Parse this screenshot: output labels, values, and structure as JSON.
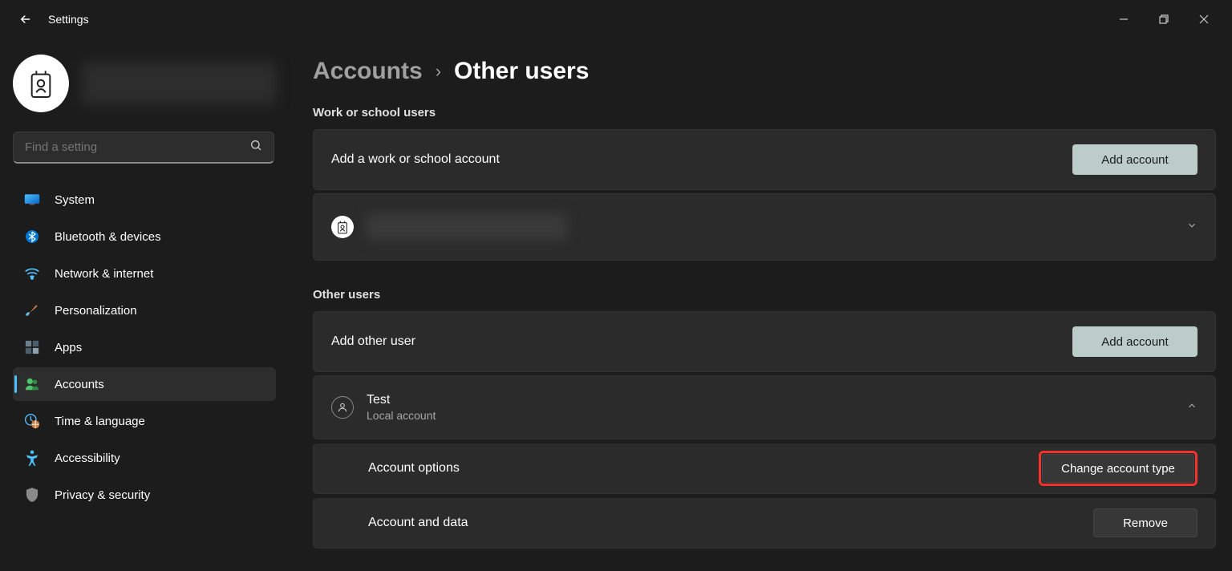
{
  "app_title": "Settings",
  "search": {
    "placeholder": "Find a setting"
  },
  "nav": {
    "items": [
      {
        "label": "System"
      },
      {
        "label": "Bluetooth & devices"
      },
      {
        "label": "Network & internet"
      },
      {
        "label": "Personalization"
      },
      {
        "label": "Apps"
      },
      {
        "label": "Accounts"
      },
      {
        "label": "Time & language"
      },
      {
        "label": "Accessibility"
      },
      {
        "label": "Privacy & security"
      }
    ],
    "selected_index": 5
  },
  "breadcrumb": {
    "parent": "Accounts",
    "current": "Other users"
  },
  "sections": {
    "work": {
      "title": "Work or school users",
      "add_label": "Add a work or school account",
      "add_button": "Add account"
    },
    "other": {
      "title": "Other users",
      "add_label": "Add other user",
      "add_button": "Add account",
      "user": {
        "name": "Test",
        "subtitle": "Local account",
        "account_options_label": "Account options",
        "change_type_button": "Change account type",
        "account_data_label": "Account and data",
        "remove_button": "Remove"
      }
    }
  }
}
